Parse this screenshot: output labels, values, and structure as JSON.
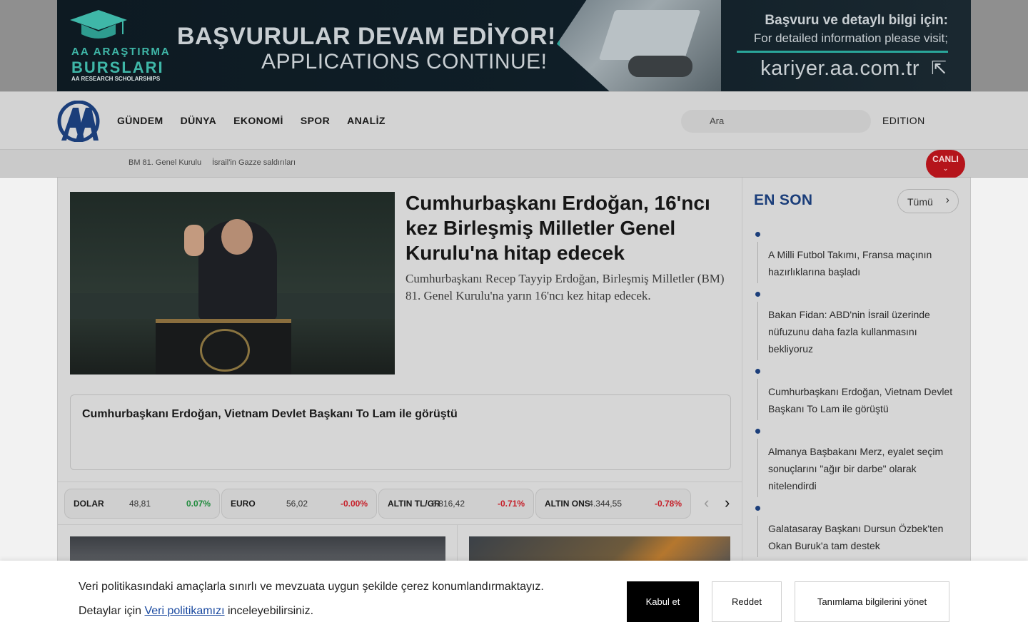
{
  "banner": {
    "logo_line1": "AA ARAŞTIRMA",
    "logo_line2": "BURSLARI",
    "logo_line3": "AA RESEARCH SCHOLARSHIPS",
    "headline_tr": "BAŞVURULAR DEVAM EDİYOR!",
    "headline_en": "APPLICATIONS CONTINUE!",
    "info_tr": "Başvuru ve detaylı bilgi için:",
    "info_en": "For detailed information please visit;",
    "url": "kariyer.aa.com.tr",
    "accent_color": "#2aa69a"
  },
  "nav": {
    "logo": "AA",
    "items": [
      {
        "label": "GÜNDEM"
      },
      {
        "label": "DÜNYA"
      },
      {
        "label": "EKONOMİ"
      },
      {
        "label": "SPOR"
      },
      {
        "label": "ANALİZ"
      }
    ],
    "search_placeholder": "Ara",
    "edition_label": "EDITION"
  },
  "subbar": {
    "tags": [
      "BM 81. Genel Kurulu",
      "İsrail'in Gazze saldırıları"
    ],
    "live_label": "CANLI",
    "live_color": "#b5141b"
  },
  "hero": {
    "title": "Cumhurbaşkanı Erdoğan, 16'ncı kez Birleşmiş Milletler Genel Kurulu'na hitap edecek",
    "description": "Cumhurbaşkanı Recep Tayyip Erdoğan, Birleşmiş Milletler (BM) 81. Genel Kurulu'na yarın 16'ncı kez hitap edecek."
  },
  "sub_headline": "Cumhurbaşkanı Erdoğan, Vietnam Devlet Başkanı To Lam ile görüştü",
  "markets": [
    {
      "name": "DOLAR",
      "value": "48,81",
      "change": "0.07%",
      "direction": "up"
    },
    {
      "name": "EURO",
      "value": "56,02",
      "change": "-0.00%",
      "direction": "down"
    },
    {
      "name": "ALTIN TL/GR",
      "value": "6.816,42",
      "change": "-0.71%",
      "direction": "down"
    },
    {
      "name": "ALTIN ONS",
      "value": "4.344,55",
      "change": "-0.78%",
      "direction": "down"
    }
  ],
  "colors": {
    "up": "#1f8a3c",
    "down": "#c6202a",
    "brand_blue": "#1b3e7a"
  },
  "sidebar": {
    "title": "EN SON",
    "all_button": "Tümü",
    "items": [
      "A Milli Futbol Takımı, Fransa maçının hazırlıklarına başladı",
      "Bakan Fidan: ABD'nin İsrail üzerinde nüfuzunu daha fazla kullanmasını bekliyoruz",
      "Cumhurbaşkanı Erdoğan, Vietnam Devlet Başkanı To Lam ile görüştü",
      "Almanya Başbakanı Merz, eyalet seçim sonuçlarını \"ağır bir darbe\" olarak nitelendirdi",
      "Galatasaray Başkanı Dursun Özbek'ten Okan Buruk'a tam destek"
    ]
  },
  "cookie": {
    "line1": "Veri politikasındaki amaçlarla sınırlı ve mevzuata uygun şekilde çerez konumlandırmaktayız.",
    "line2_prefix": "Detaylar için",
    "policy_link": "Veri politikamızı",
    "line2_suffix": "inceleyebilirsiniz.",
    "accept": "Kabul et",
    "reject": "Reddet",
    "manage": "Tanımlama bilgilerini yönet"
  }
}
